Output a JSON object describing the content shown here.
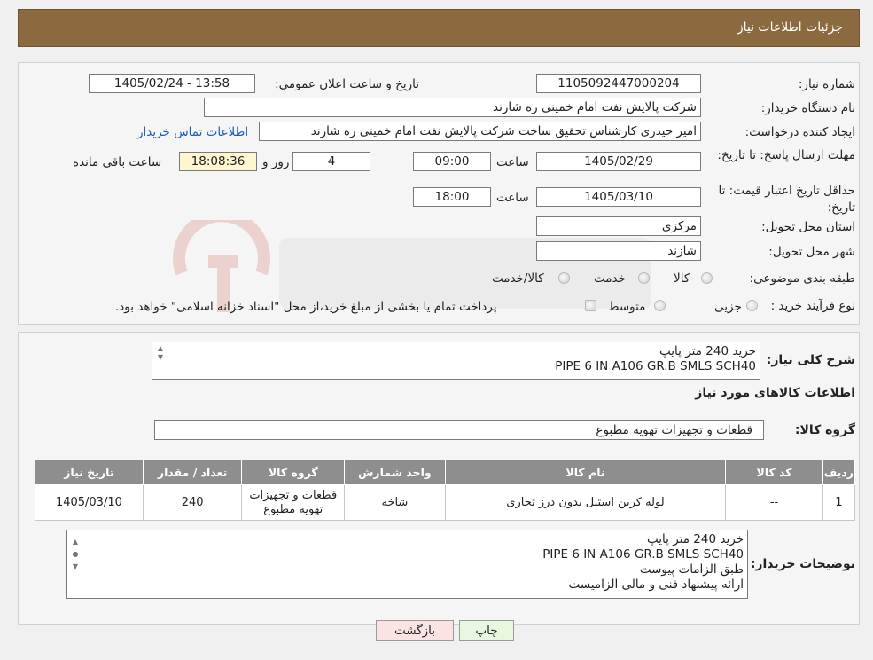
{
  "page_title": "جزئیات اطلاعات نیاز",
  "fields": {
    "need_number_label": "شماره نیاز:",
    "need_number": "1105092447000204",
    "announce_label": "تاریخ و ساعت اعلان عمومی:",
    "announce_value": "1405/02/24 - 13:58",
    "buyer_org_label": "نام دستگاه خریدار:",
    "buyer_org": "شرکت پالایش نفت امام خمینی  ره  شازند",
    "creator_label": "ایجاد کننده درخواست:",
    "creator": "امیر  حیدری کارشناس تحقیق ساخت شرکت پالایش نفت امام خمینی  ره  شازند",
    "contact_link": "اطلاعات تماس خریدار",
    "deadline_label": "مهلت ارسال پاسخ: تا تاریخ:",
    "deadline_date": "1405/02/29",
    "time_label": "ساعت",
    "deadline_time": "09:00",
    "days_remaining": "4",
    "days_label": "روز و",
    "countdown": "18:08:36",
    "remaining_label": "ساعت باقی مانده",
    "validity_label": "حداقل تاریخ اعتبار قیمت: تا تاریخ:",
    "validity_date": "1405/03/10",
    "validity_time": "18:00",
    "province_label": "استان محل تحویل:",
    "province": "مرکزی",
    "city_label": "شهر محل تحویل:",
    "city": "شازند",
    "category_label": "طبقه بندی موضوعی:",
    "category_options": [
      "کالا",
      "خدمت",
      "کالا/خدمت"
    ],
    "process_label": "نوع فرآیند خرید :",
    "process_options": [
      "جزیی",
      "متوسط"
    ],
    "process_note": "پرداخت تمام یا بخشی از مبلغ خرید،از محل \"اسناد خزانه اسلامی\" خواهد بود."
  },
  "summary": {
    "label": "شرح کلی نیاز:",
    "lines": [
      "خرید 240 متر پایپ",
      "PIPE 6 IN  A106 GR.B SMLS SCH40"
    ]
  },
  "goods_info_title": "اطلاعات کالاهای مورد نیاز",
  "goods_group": {
    "label": "گروه کالا:",
    "value": "قطعات و تجهیزات تهویه مطبوع"
  },
  "table": {
    "headers": [
      "ردیف",
      "کد کالا",
      "نام کالا",
      "واحد شمارش",
      "گروه کالا",
      "تعداد / مقدار",
      "تاریخ نیاز"
    ],
    "row": [
      "1",
      "--",
      "لوله کربن استیل بدون درز تجاری",
      "شاخه",
      "قطعات و تجهیزات تهویه مطبوع",
      "240",
      "1405/03/10"
    ]
  },
  "buyer_notes": {
    "label": "توضیحات خریدار:",
    "lines": [
      "خرید 240 متر پایپ",
      "PIPE 6 IN  A106 GR.B SMLS SCH40",
      "طبق الزامات پیوست",
      "ارائه پیشنهاد فنی و مالی الزامیست"
    ]
  },
  "buttons": {
    "print": "چاپ",
    "back": "بازگشت"
  },
  "colors": {
    "header": "#8b6a3f",
    "table_header": "#8e8e8e",
    "countdown_bg": "#fdf6cf",
    "link": "#1a5bb8",
    "back_button": "#fbe3e3",
    "print_button": "#e8f7df"
  }
}
